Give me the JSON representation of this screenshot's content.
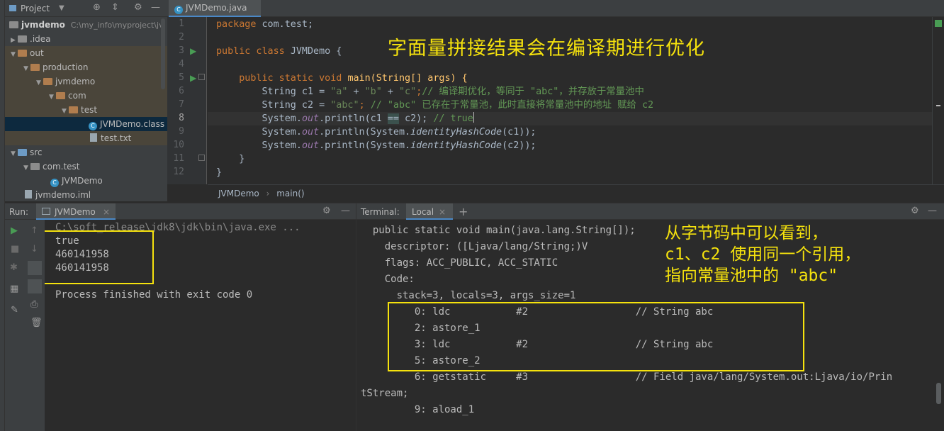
{
  "project_panel": {
    "title": "Project",
    "tree": [
      {
        "label": "jvmdemo",
        "sublabel": "C:\\my_info\\myproject\\jv"
      },
      {
        "label": ".idea"
      },
      {
        "label": "out"
      },
      {
        "label": "production"
      },
      {
        "label": "jvmdemo"
      },
      {
        "label": "com"
      },
      {
        "label": "test"
      },
      {
        "label": "JVMDemo.class"
      },
      {
        "label": "test.txt"
      },
      {
        "label": "src"
      },
      {
        "label": "com.test"
      },
      {
        "label": "JVMDemo"
      },
      {
        "label": "jvmdemo.iml"
      }
    ]
  },
  "editor": {
    "tab_label": "JVMDemo.java",
    "line_numbers": [
      "1",
      "2",
      "3",
      "4",
      "5",
      "6",
      "7",
      "8",
      "9",
      "10",
      "11",
      "12"
    ],
    "breadcrumb": {
      "class": "JVMDemo",
      "separator": "›",
      "method": "main()"
    },
    "annotation": "字面量拼接结果会在编译期进行优化",
    "code": {
      "l1_kw": "package ",
      "l1_rest": "com.test;",
      "l3_kw": "public class ",
      "l3_rest": "JVMDemo {",
      "l5_kw": "    public static void ",
      "l5_rest": "main(String[] args) {",
      "l6_a": "        String c1 = ",
      "l6_s1": "\"a\"",
      "l6_p1": " + ",
      "l6_s2": "\"b\"",
      "l6_p2": " + ",
      "l6_s3": "\"c\"",
      "l6_semi": ";",
      "l6_cm": "// 编译期优化，等同于 \"abc\"，并存放于常量池中",
      "l7_a": "        String c2 = ",
      "l7_s": "\"abc\"",
      "l7_semi": "; ",
      "l7_cm": "// \"abc\" 已存在于常量池，此时直接将常量池中的地址 赋给 c2",
      "l8_a": "        System.",
      "l8_out": "out",
      "l8_b": ".println(c1 ",
      "l8_eq": "==",
      "l8_c": " c2); ",
      "l8_cm": "// true",
      "l9_a": "        System.",
      "l9_out": "out",
      "l9_b": ".println(System.",
      "l9_it": "identityHashCode",
      "l9_c": "(c1));",
      "l10_a": "        System.",
      "l10_out": "out",
      "l10_b": ".println(System.",
      "l10_it": "identityHashCode",
      "l10_c": "(c2));",
      "l11": "    }",
      "l12": "}"
    }
  },
  "run_panel": {
    "label": "Run:",
    "tab_label": "JVMDemo",
    "output": [
      "C:\\soft_release\\jdk8\\jdk\\bin\\java.exe ...",
      "true",
      "460141958",
      "460141958",
      "",
      "Process finished with exit code 0"
    ]
  },
  "terminal_panel": {
    "label": "Terminal:",
    "tab_label": "Local",
    "output": [
      "  public static void main(java.lang.String[]);",
      "    descriptor: ([Ljava/lang/String;)V",
      "    flags: ACC_PUBLIC, ACC_STATIC",
      "    Code:",
      "      stack=3, locals=3, args_size=1",
      "         0: ldc           #2                  // String abc",
      "         2: astore_1",
      "         3: ldc           #2                  // String abc",
      "         5: astore_2",
      "         6: getstatic     #3                  // Field java/lang/System.out:Ljava/io/Prin",
      "tStream;",
      "         9: aload_1"
    ],
    "annotation": "从字节码中可以看到，\nc1、c2 使用同一个引用，\n指向常量池中的 \"abc\""
  },
  "icons": {
    "run": "play-icon",
    "stop": "stop-icon",
    "settings": "gear-icon",
    "hide": "minimize-icon",
    "add": "plus-icon",
    "close": "close-icon",
    "target": "locate-icon",
    "collapse": "collapse-icon"
  },
  "colors": {
    "annotation": "#f5e20d",
    "keyword": "#cc7832",
    "string": "#6a8759",
    "comment": "#629755",
    "field": "#9876aa",
    "selection": "#0d293e"
  }
}
